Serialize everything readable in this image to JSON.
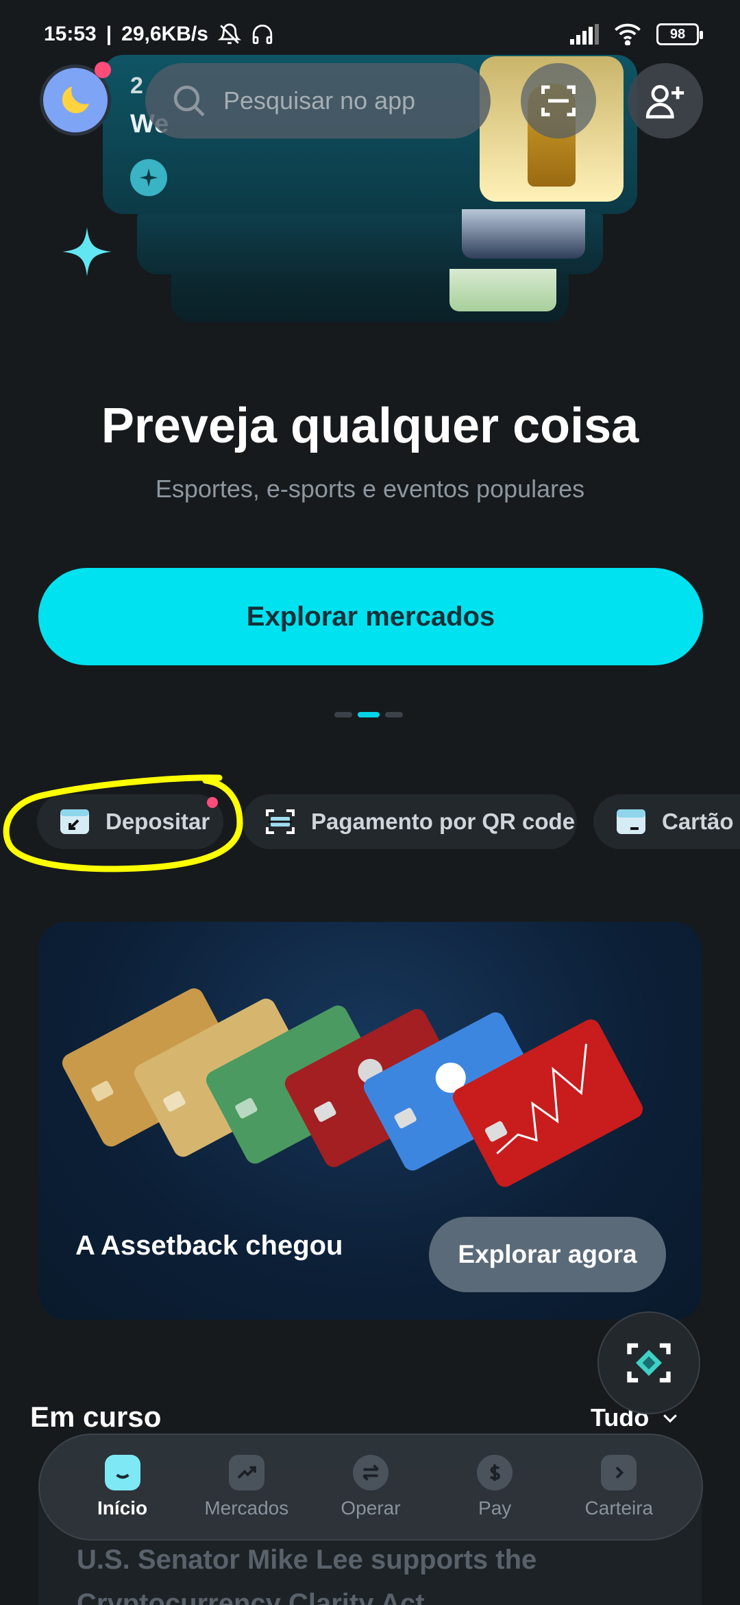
{
  "status_bar": {
    "time": "15:53",
    "network_speed": "29,6KB/s",
    "battery": "98"
  },
  "top_bar": {
    "search_placeholder": "Pesquisar no app"
  },
  "hero": {
    "peek_number": "2",
    "peek_text": "We",
    "title": "Preveja qualquer coisa",
    "subtitle": "Esportes, e-sports e eventos populares",
    "cta_label": "Explorar mercados"
  },
  "pager": {
    "count": 3,
    "active_index": 1
  },
  "quick_actions": [
    {
      "label": "Depositar",
      "icon": "deposit-icon"
    },
    {
      "label": "Pagamento por QR code",
      "icon": "qr-scan-icon"
    },
    {
      "label": "Cartão",
      "icon": "card-icon"
    }
  ],
  "banner": {
    "title": "A Assetback chegou",
    "button_label": "Explorar agora"
  },
  "in_progress": {
    "title": "Em curso",
    "see_all_label": "Tudo",
    "news_text": "U.S. Senator Mike Lee supports the Cryptocurrency Clarity Act"
  },
  "bottom_nav": [
    {
      "label": "Início",
      "icon": "home-icon",
      "active": true
    },
    {
      "label": "Mercados",
      "icon": "chart-icon",
      "active": false
    },
    {
      "label": "Operar",
      "icon": "swap-icon",
      "active": false
    },
    {
      "label": "Pay",
      "icon": "dollar-icon",
      "active": false
    },
    {
      "label": "Carteira",
      "icon": "wallet-icon",
      "active": false
    }
  ],
  "colors": {
    "accent": "#00e2f0",
    "background": "#161a1d",
    "notification_dot": "#ff4d7a",
    "annotation": "#ffff00"
  }
}
